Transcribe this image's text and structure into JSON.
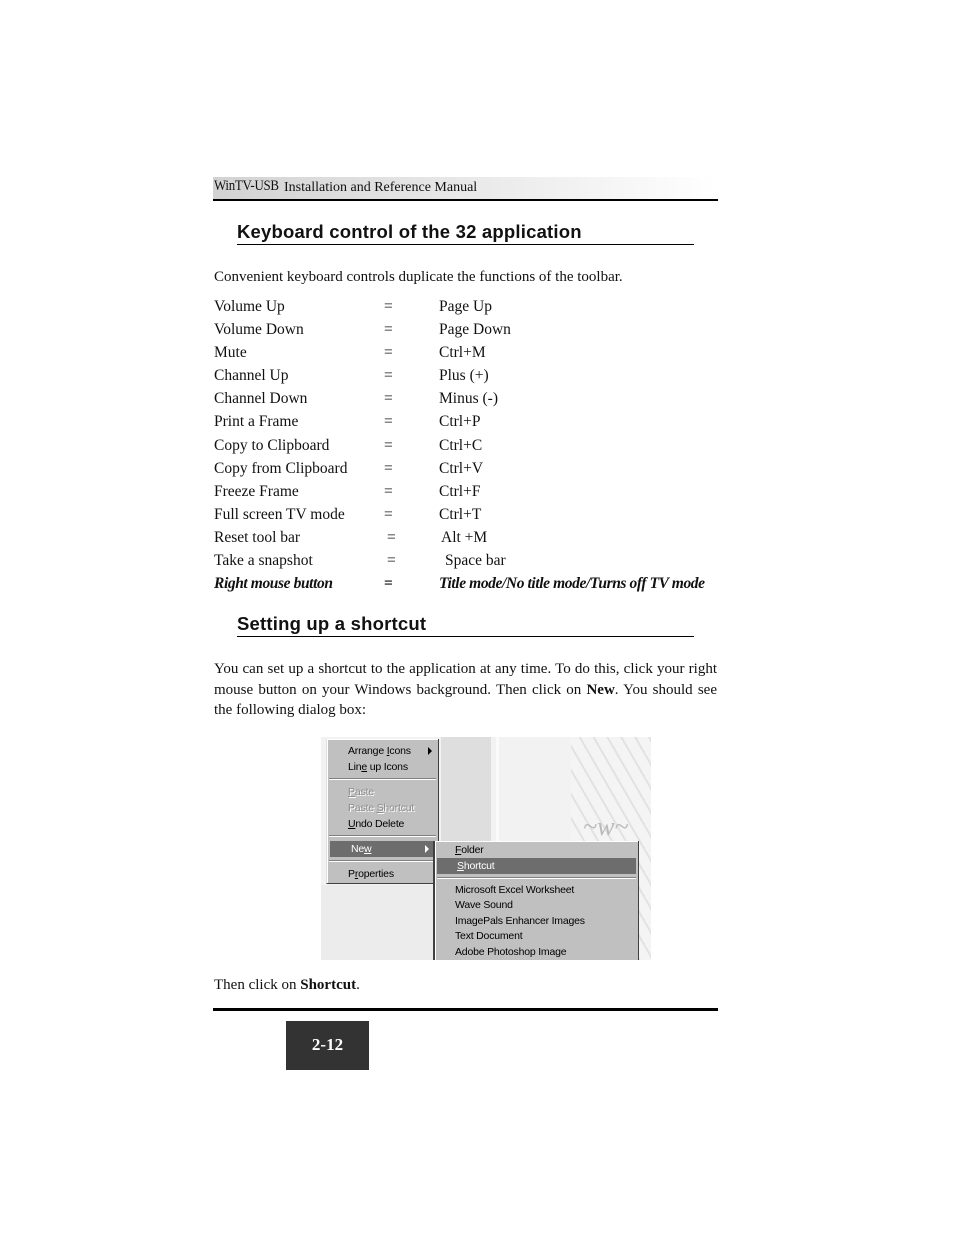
{
  "header": {
    "brand": "WinTV-USB",
    "title": "Installation and Reference Manual"
  },
  "section1": {
    "heading": "Keyboard control of the 32 application",
    "intro": "Convenient keyboard controls duplicate the functions of the  toolbar.",
    "shortcuts": [
      {
        "function": "Volume Up",
        "eq": "=",
        "key": "Page Up"
      },
      {
        "function": "Volume Down",
        "eq": "=",
        "key": "Page Down"
      },
      {
        "function": "Mute",
        "eq": "=",
        "key": "Ctrl+M"
      },
      {
        "function": "Channel Up",
        "eq": "=",
        "key": "Plus (+)"
      },
      {
        "function": "Channel Down",
        "eq": "=",
        "key": "Minus (-)"
      },
      {
        "function": "Print a Frame",
        "eq": "=",
        "key": "Ctrl+P"
      },
      {
        "function": "Copy to Clipboard",
        "eq": "=",
        "key": "Ctrl+C"
      },
      {
        "function": "Copy from Clipboard",
        "eq": "=",
        "key": "Ctrl+V"
      },
      {
        "function": "Freeze Frame",
        "eq": "=",
        "key": "Ctrl+F"
      },
      {
        "function": "Full screen TV mode",
        "eq": "=",
        "key": "Ctrl+T"
      },
      {
        "function": "Reset tool bar",
        "eq": "=",
        "key": "Alt +M"
      },
      {
        "function": "Take a snapshot",
        "eq": "=",
        "key": "Space bar"
      },
      {
        "function": "Right mouse button",
        "eq": "=",
        "key": "Title mode/No title mode/Turns off TV mode"
      }
    ]
  },
  "section2": {
    "heading": "Setting up a shortcut",
    "para_part1": "You can set up a shortcut to the  application at any time. To do this, click your right mouse button on your Windows background. Then click on ",
    "para_bold": "New",
    "para_part2": ". You should see the following dialog box:",
    "then_part1": "Then click on ",
    "then_bold": "Shortcut",
    "then_part2": "."
  },
  "context_menu": {
    "items": [
      {
        "pre": "Arrange ",
        "u": "I",
        "post": "cons",
        "submenu": true
      },
      {
        "pre": "Lin",
        "u": "e",
        "post": " up Icons"
      },
      {
        "pre": "",
        "u": "P",
        "post": "aste",
        "disabled": true
      },
      {
        "pre": "Paste ",
        "u": "S",
        "post": "hortcut",
        "disabled": true
      },
      {
        "pre": "",
        "u": "U",
        "post": "ndo Delete"
      },
      {
        "pre": "Ne",
        "u": "w",
        "post": "",
        "submenu": true,
        "highlighted": true
      },
      {
        "pre": "P",
        "u": "r",
        "post": "operties"
      }
    ]
  },
  "new_submenu": {
    "items": [
      {
        "pre": "",
        "u": "F",
        "post": "older"
      },
      {
        "pre": "",
        "u": "S",
        "post": "hortcut",
        "highlighted": true
      },
      {
        "label": "Microsoft Excel Worksheet"
      },
      {
        "label": "Wave Sound"
      },
      {
        "label": "ImagePals Enhancer Images"
      },
      {
        "label": "Text Document"
      },
      {
        "label": "Adobe Photoshop Image"
      }
    ]
  },
  "footer": {
    "page_number": "2-12"
  }
}
